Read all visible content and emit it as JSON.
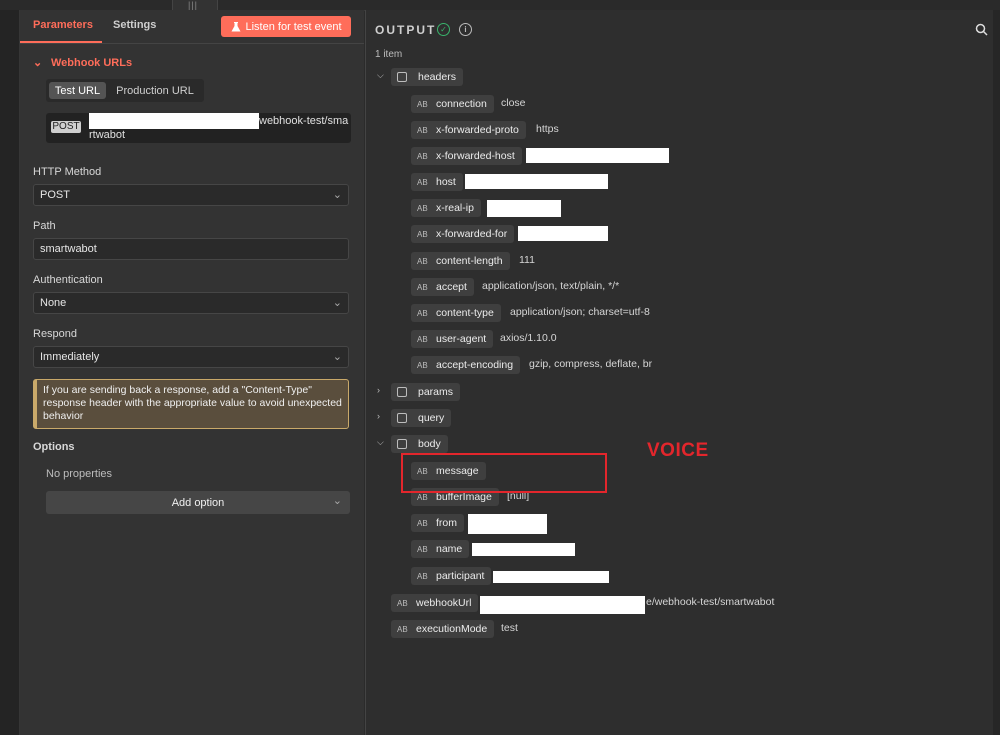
{
  "left_panel": {
    "tabs": [
      "Parameters",
      "Settings"
    ],
    "listen_button": "Listen for test event",
    "webhook_urls_title": "Webhook URLs",
    "url_toggle": [
      "Test URL",
      "Production URL"
    ],
    "url_method": "POST",
    "url_line1": "webhook-test/sma",
    "url_line2": "rtwabot",
    "http_method": {
      "label": "HTTP Method",
      "value": "POST"
    },
    "path": {
      "label": "Path",
      "value": "smartwabot"
    },
    "authentication": {
      "label": "Authentication",
      "value": "None"
    },
    "respond": {
      "label": "Respond",
      "value": "Immediately"
    },
    "notice": "If you are sending back a response, add a \"Content-Type\" response header with the appropriate value to avoid unexpected behavior",
    "options": {
      "label": "Options",
      "empty": "No properties",
      "add_button": "Add option"
    }
  },
  "output": {
    "title": "OUTPUT",
    "count": "1 item",
    "headers": {
      "label": "headers",
      "fields": [
        {
          "key": "connection",
          "value": "close"
        },
        {
          "key": "x-forwarded-proto",
          "value": "https"
        },
        {
          "key": "x-forwarded-host",
          "value": ""
        },
        {
          "key": "host",
          "value": ""
        },
        {
          "key": "x-real-ip",
          "value": ""
        },
        {
          "key": "x-forwarded-for",
          "value": ""
        },
        {
          "key": "content-length",
          "value": "111"
        },
        {
          "key": "accept",
          "value": "application/json, text/plain, */*"
        },
        {
          "key": "content-type",
          "value": "application/json; charset=utf-8"
        },
        {
          "key": "user-agent",
          "value": "axios/1.10.0"
        },
        {
          "key": "accept-encoding",
          "value": "gzip, compress, deflate, br"
        }
      ]
    },
    "params_label": "params",
    "query_label": "query",
    "body": {
      "label": "body",
      "fields": [
        {
          "key": "message",
          "value": ""
        },
        {
          "key": "bufferImage",
          "value": "[null]"
        },
        {
          "key": "from",
          "value": ""
        },
        {
          "key": "name",
          "value": ""
        },
        {
          "key": "participant",
          "value": ""
        }
      ]
    },
    "webhook_url": {
      "key": "webhookUrl",
      "value": "e/webhook-test/smartwabot"
    },
    "execution_mode": {
      "key": "executionMode",
      "value": "test"
    },
    "type_icon_text": "AB"
  },
  "annotation": {
    "label": "VOICE",
    "color": "#e3262c"
  },
  "colors": {
    "accent": "#ff6d5a",
    "success": "#39b36b",
    "warning_border": "#c9a96a"
  }
}
